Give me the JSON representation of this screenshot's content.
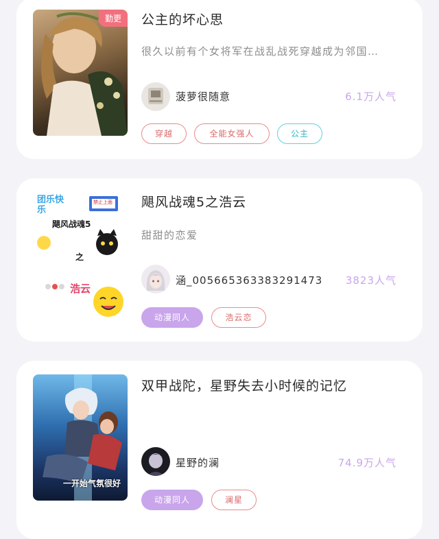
{
  "books": [
    {
      "badge": "勤更",
      "title": "公主的坏心思",
      "desc": "很久以前有个女将军在战乱战死穿越成为邻国…",
      "author": "菠萝很随意",
      "popularity": "6.1万人气",
      "tags": [
        "穿越",
        "全能女强人",
        "公主"
      ]
    },
    {
      "title": "飓风战魂5之浩云",
      "desc": "甜甜的恋爱",
      "author": "涵_005665363383291473",
      "popularity": "3823人气",
      "tags": [
        "动漫同人",
        "浩云恋"
      ],
      "cover_text": {
        "line1": "团乐快乐",
        "line2": "飓风战魂5",
        "line3": "之",
        "line4": "浩云",
        "sign": "禁止上面"
      }
    },
    {
      "title": "双甲战陀，星野失去小时候的记忆",
      "desc": "",
      "author": "星野的澜",
      "popularity": "74.9万人气",
      "tags": [
        "动漫同人",
        "澜星"
      ],
      "cover_caption": "一开始气氛很好"
    }
  ],
  "colors": {
    "popularity": "#c9a5ec",
    "badge": "#f2707e",
    "tag_red": "#e88a8a",
    "tag_cyan": "#5fd0dc",
    "tag_purple": "#c9a5ec"
  }
}
